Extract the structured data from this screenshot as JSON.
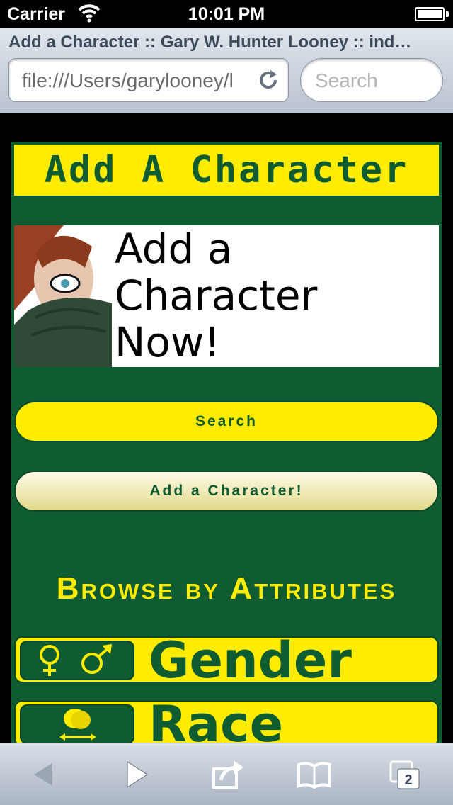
{
  "status_bar": {
    "carrier": "Carrier",
    "time": "10:01 PM"
  },
  "browser": {
    "page_title": "Add a Character :: Gary W. Hunter Looney :: ind…",
    "url": "file:///Users/garylooney/l",
    "search_placeholder": "Search",
    "tab_count": "2"
  },
  "page": {
    "heading": "Add A Character",
    "promo_text": "Add a\nCharacter\nNow!",
    "search_button": "Search",
    "add_button": "Add a Character!",
    "browse_heading": "Browse by Attributes",
    "attributes": [
      {
        "label": "Gender",
        "icon": "gender-symbols-icon"
      },
      {
        "label": "Race",
        "icon": "race-heads-icon"
      }
    ]
  },
  "colors": {
    "brand_green": "#0f5c33",
    "brand_yellow": "#ffec00"
  },
  "toolbar": {
    "icons": [
      "back-icon",
      "forward-icon",
      "share-icon",
      "bookmarks-icon",
      "tabs-icon"
    ]
  }
}
